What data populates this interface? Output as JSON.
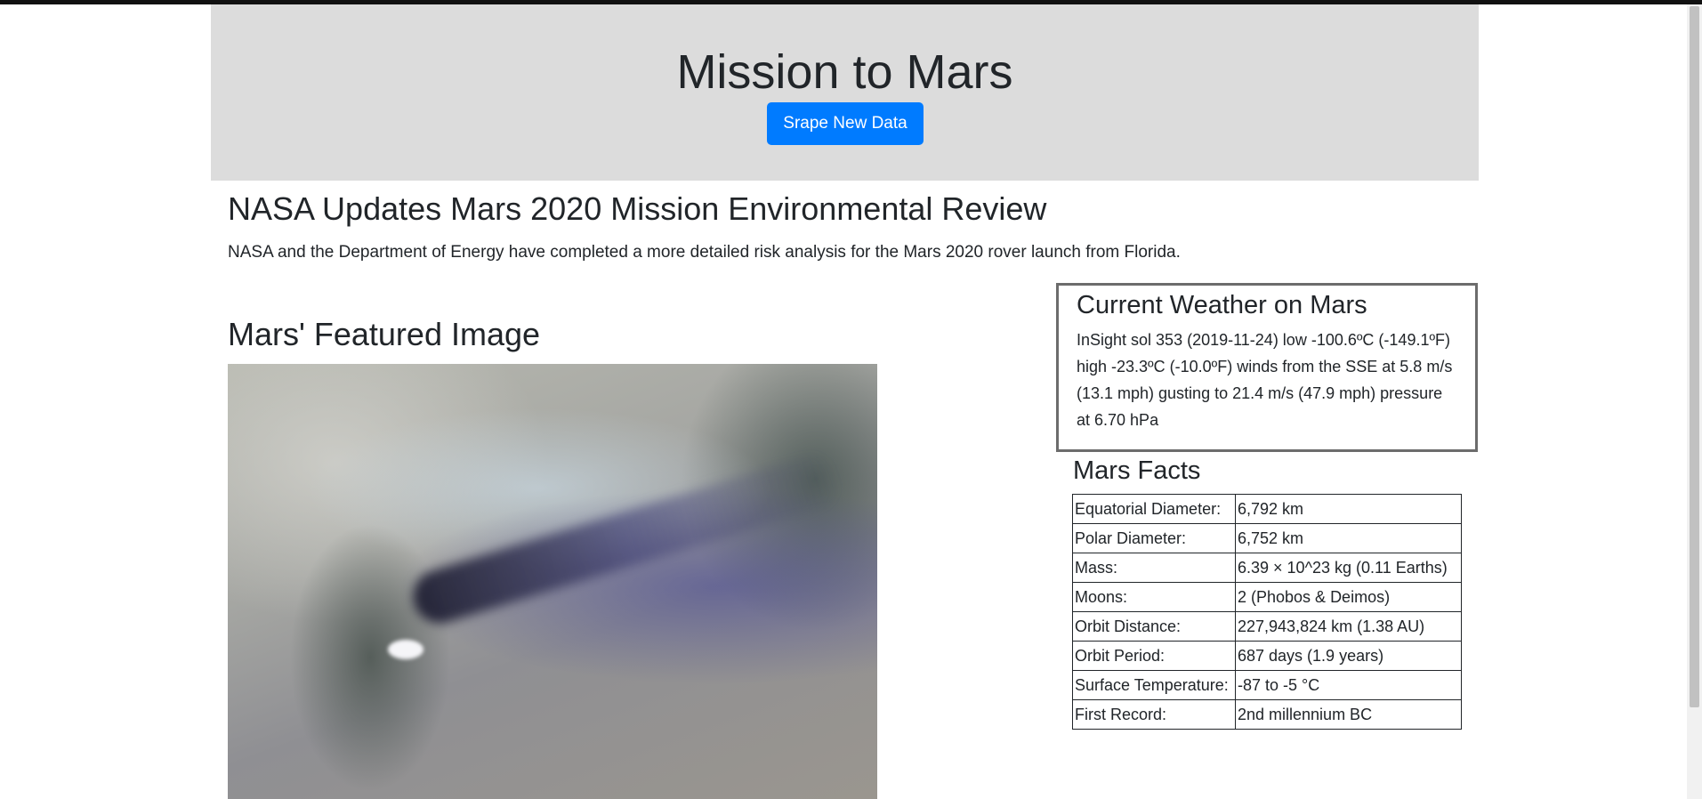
{
  "header": {
    "title": "Mission to Mars",
    "scrape_button": "Srape New Data"
  },
  "news": {
    "title": "NASA Updates Mars 2020 Mission Environmental Review",
    "teaser": "NASA and the Department of Energy have completed a more detailed risk analysis for the Mars 2020 rover launch from Florida."
  },
  "featured": {
    "title": "Mars' Featured Image"
  },
  "weather": {
    "title": "Current Weather on Mars",
    "text": "InSight sol 353 (2019-11-24) low -100.6ºC (-149.1ºF) high -23.3ºC (-10.0ºF) winds from the SSE at 5.8 m/s (13.1 mph) gusting to 21.4 m/s (47.9 mph) pressure at 6.70 hPa"
  },
  "facts": {
    "title": "Mars Facts",
    "rows": [
      {
        "label": "Equatorial Diameter:",
        "value": "6,792 km"
      },
      {
        "label": "Polar Diameter:",
        "value": "6,752 km"
      },
      {
        "label": "Mass:",
        "value": "6.39 × 10^23 kg (0.11 Earths)"
      },
      {
        "label": "Moons:",
        "value": "2 (Phobos & Deimos)"
      },
      {
        "label": "Orbit Distance:",
        "value": "227,943,824 km (1.38 AU)"
      },
      {
        "label": "Orbit Period:",
        "value": "687 days (1.9 years)"
      },
      {
        "label": "Surface Temperature:",
        "value": "-87 to -5 °C"
      },
      {
        "label": "First Record:",
        "value": "2nd millennium BC"
      }
    ]
  },
  "colors": {
    "jumbotron_bg": "#dcdcdc",
    "button_bg": "#007bff"
  }
}
